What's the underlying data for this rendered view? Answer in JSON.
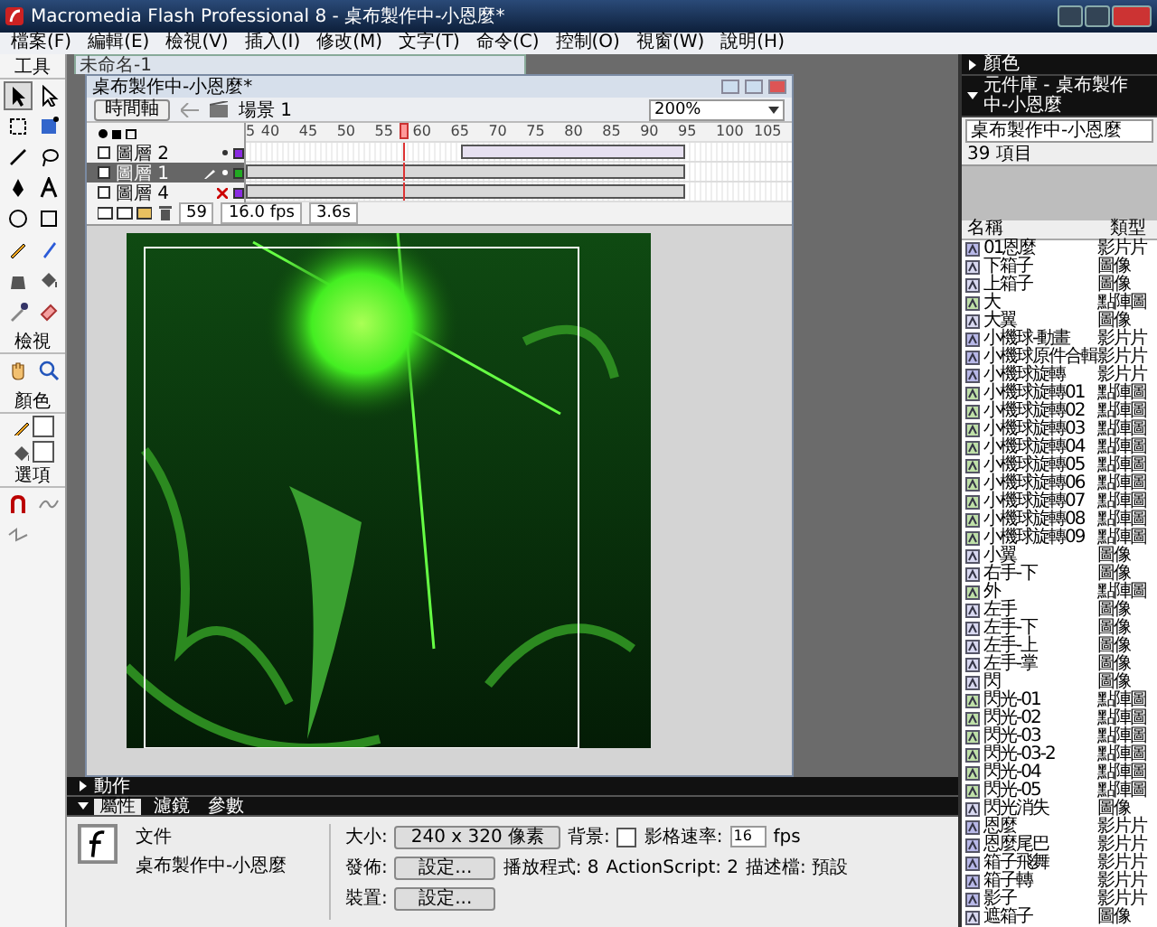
{
  "window": {
    "title": "Macromedia Flash Professional 8 - 桌布製作中-小恩麼*"
  },
  "menu": [
    "檔案(F)",
    "編輯(E)",
    "檢視(V)",
    "插入(I)",
    "修改(M)",
    "文字(T)",
    "命令(C)",
    "控制(O)",
    "視窗(W)",
    "說明(H)"
  ],
  "tools": {
    "title": "工具",
    "items": [
      {
        "kind": "arrow",
        "selected": true
      },
      {
        "kind": "subselect",
        "selected": false
      },
      {
        "kind": "transform",
        "selected": false
      },
      {
        "kind": "gradient",
        "selected": false
      },
      {
        "kind": "line",
        "selected": false
      },
      {
        "kind": "lasso",
        "selected": false
      },
      {
        "kind": "pen",
        "selected": false
      },
      {
        "kind": "text",
        "selected": false
      },
      {
        "kind": "oval",
        "selected": false
      },
      {
        "kind": "rect",
        "selected": false
      },
      {
        "kind": "pencil",
        "selected": false
      },
      {
        "kind": "brush",
        "selected": false
      },
      {
        "kind": "ink",
        "selected": false
      },
      {
        "kind": "bucket",
        "selected": false
      },
      {
        "kind": "eyedropper",
        "selected": false
      },
      {
        "kind": "eraser",
        "selected": false
      }
    ],
    "view_title": "檢視",
    "view_items": [
      {
        "kind": "hand",
        "selected": false
      },
      {
        "kind": "zoom",
        "selected": false
      }
    ],
    "colors_title": "顏色",
    "options_title": "選項",
    "options": [
      {
        "kind": "magnet",
        "selected": false
      },
      {
        "kind": "smooth",
        "selected": false
      },
      {
        "kind": "straighten",
        "selected": false
      }
    ]
  },
  "back_document": {
    "title": "未命名-1"
  },
  "document": {
    "title": "桌布製作中-小恩麼*",
    "timeline_button": "時間軸",
    "scene": "場景 1",
    "zoom": "200%",
    "ruler": [
      "5",
      "40",
      "45",
      "50",
      "55",
      "60",
      "65",
      "70",
      "75",
      "80",
      "85",
      "90",
      "95",
      "100",
      "105"
    ],
    "playhead": {
      "level": 0.288
    },
    "layers": [
      {
        "name": "圖層 2",
        "selected": false,
        "hidden": false,
        "color": "#8a2be2",
        "tween": true
      },
      {
        "name": "圖層 1",
        "selected": true,
        "hidden": false,
        "color": "#22aa22",
        "tween": false
      },
      {
        "name": "圖層 4",
        "selected": false,
        "hidden": true,
        "color": "#8a2be2",
        "tween": false
      }
    ],
    "current_frame": "59",
    "fps": "16.0 fps",
    "time": "3.6s"
  },
  "color_panel": {
    "title": "顏色",
    "expanded": false
  },
  "library": {
    "title": "元件庫 - 桌布製作中-小恩麼",
    "expanded": true,
    "document": "桌布製作中-小恩麼",
    "count": "39 項目",
    "columns": [
      "名稱",
      "類型"
    ],
    "items": [
      {
        "name": "01恩麼",
        "type": "影片片",
        "kind": "movieclip"
      },
      {
        "name": "下箱子",
        "type": "圖像",
        "kind": "graphic"
      },
      {
        "name": "上箱子",
        "type": "圖像",
        "kind": "graphic"
      },
      {
        "name": "大",
        "type": "點陣圖",
        "kind": "bitmap"
      },
      {
        "name": "大翼",
        "type": "圖像",
        "kind": "graphic"
      },
      {
        "name": "小機球-動畫",
        "type": "影片片",
        "kind": "movieclip"
      },
      {
        "name": "小機球原件合輯",
        "type": "影片片",
        "kind": "movieclip"
      },
      {
        "name": "小機球旋轉",
        "type": "影片片",
        "kind": "movieclip"
      },
      {
        "name": "小機球旋轉01",
        "type": "點陣圖",
        "kind": "bitmap"
      },
      {
        "name": "小機球旋轉02",
        "type": "點陣圖",
        "kind": "bitmap"
      },
      {
        "name": "小機球旋轉03",
        "type": "點陣圖",
        "kind": "bitmap"
      },
      {
        "name": "小機球旋轉04",
        "type": "點陣圖",
        "kind": "bitmap"
      },
      {
        "name": "小機球旋轉05",
        "type": "點陣圖",
        "kind": "bitmap"
      },
      {
        "name": "小機球旋轉06",
        "type": "點陣圖",
        "kind": "bitmap"
      },
      {
        "name": "小機球旋轉07",
        "type": "點陣圖",
        "kind": "bitmap"
      },
      {
        "name": "小機球旋轉08",
        "type": "點陣圖",
        "kind": "bitmap"
      },
      {
        "name": "小機球旋轉09",
        "type": "點陣圖",
        "kind": "bitmap"
      },
      {
        "name": "小翼",
        "type": "圖像",
        "kind": "graphic"
      },
      {
        "name": "右手-下",
        "type": "圖像",
        "kind": "graphic"
      },
      {
        "name": "外",
        "type": "點陣圖",
        "kind": "bitmap"
      },
      {
        "name": "左手",
        "type": "圖像",
        "kind": "graphic"
      },
      {
        "name": "左手-下",
        "type": "圖像",
        "kind": "graphic"
      },
      {
        "name": "左手-上",
        "type": "圖像",
        "kind": "graphic"
      },
      {
        "name": "左手-掌",
        "type": "圖像",
        "kind": "graphic"
      },
      {
        "name": "閃",
        "type": "圖像",
        "kind": "graphic"
      },
      {
        "name": "閃光-01",
        "type": "點陣圖",
        "kind": "bitmap"
      },
      {
        "name": "閃光-02",
        "type": "點陣圖",
        "kind": "bitmap"
      },
      {
        "name": "閃光-03",
        "type": "點陣圖",
        "kind": "bitmap"
      },
      {
        "name": "閃光-03-2",
        "type": "點陣圖",
        "kind": "bitmap"
      },
      {
        "name": "閃光-04",
        "type": "點陣圖",
        "kind": "bitmap"
      },
      {
        "name": "閃光-05",
        "type": "點陣圖",
        "kind": "bitmap"
      },
      {
        "name": "閃光消失",
        "type": "圖像",
        "kind": "graphic"
      },
      {
        "name": "恩麼",
        "type": "影片片",
        "kind": "movieclip"
      },
      {
        "name": "恩麼尾巴",
        "type": "影片片",
        "kind": "movieclip"
      },
      {
        "name": "箱子飛舞",
        "type": "影片片",
        "kind": "movieclip"
      },
      {
        "name": "箱子轉",
        "type": "影片片",
        "kind": "movieclip"
      },
      {
        "name": "影子",
        "type": "影片片",
        "kind": "movieclip"
      },
      {
        "name": "遮箱子",
        "type": "圖像",
        "kind": "graphic"
      }
    ]
  },
  "actions_panel": {
    "title": "動作",
    "expanded": false
  },
  "properties": {
    "expanded": true,
    "tabs": [
      {
        "label": "屬性",
        "selected": true
      },
      {
        "label": "濾鏡",
        "selected": false
      },
      {
        "label": "參數",
        "selected": false
      }
    ],
    "doc_type": "文件",
    "doc_name": "桌布製作中-小恩麼",
    "size_label": "大小:",
    "size": "240 x 320 像素",
    "background_label": "背景:",
    "fps_label": "影格速率:",
    "fps": "16",
    "fps_unit": "fps",
    "publish_label": "發佈:",
    "publish_button": "設定...",
    "player": "播放程式: 8",
    "actionscript": "ActionScript: 2",
    "profile": "描述檔: 預設",
    "device_label": "裝置:",
    "device_button": "設定..."
  }
}
